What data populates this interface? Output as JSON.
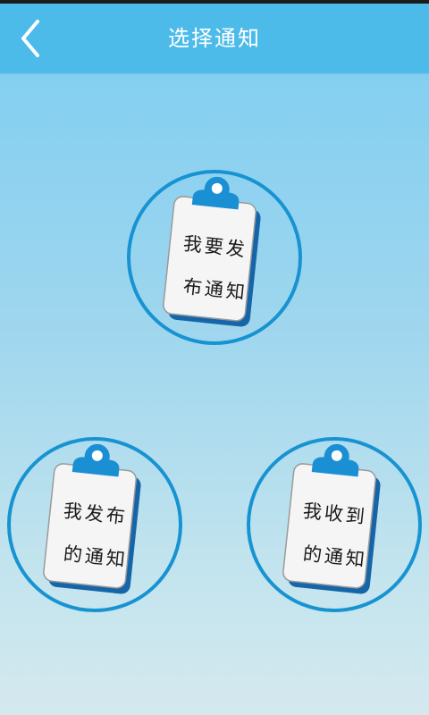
{
  "header": {
    "title": "选择通知",
    "back_icon": "chevron-left-icon"
  },
  "options": {
    "publish": {
      "line1": "我要发",
      "line2": "布通知",
      "icon": "clipboard-icon"
    },
    "published": {
      "line1": "我发布",
      "line2": "的通知",
      "icon": "clipboard-icon"
    },
    "received": {
      "line1": "我收到",
      "line2": "的通知",
      "icon": "clipboard-icon"
    }
  },
  "colors": {
    "title_bar": "#4dbbe9",
    "ring": "#1793d2",
    "clip": "#1a8fd4",
    "board": "#f4f4f4"
  }
}
